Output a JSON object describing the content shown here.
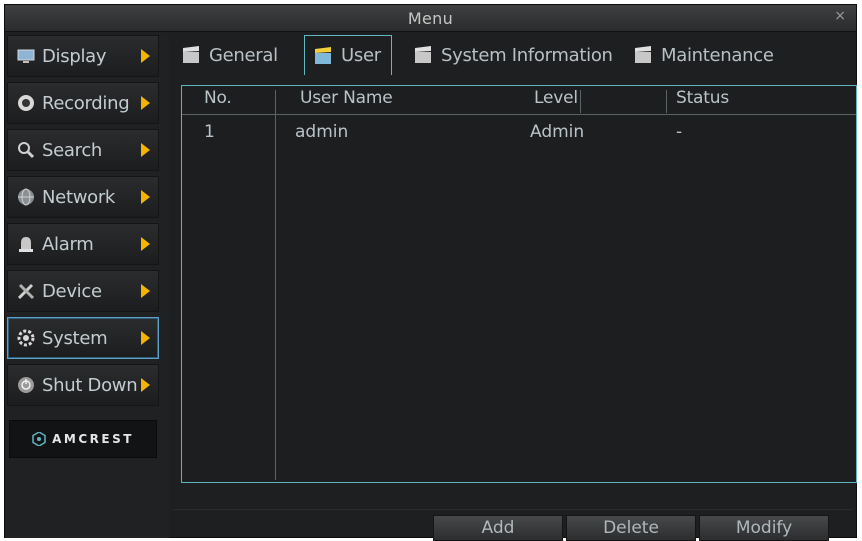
{
  "window": {
    "title": "Menu",
    "close_glyph": "×"
  },
  "sidebar": {
    "items": [
      {
        "label": "Display",
        "icon": "monitor-icon"
      },
      {
        "label": "Recording",
        "icon": "record-icon"
      },
      {
        "label": "Search",
        "icon": "search-icon"
      },
      {
        "label": "Network",
        "icon": "network-globe-icon"
      },
      {
        "label": "Alarm",
        "icon": "alarm-bell-icon"
      },
      {
        "label": "Device",
        "icon": "tools-icon"
      },
      {
        "label": "System",
        "icon": "gear-icon",
        "active": true
      },
      {
        "label": "Shut Down",
        "icon": "power-icon"
      }
    ],
    "logo": "AMCREST"
  },
  "tabs": [
    {
      "label": "General",
      "icon": "clapper-icon"
    },
    {
      "label": "User",
      "icon": "clapper-icon",
      "active": true
    },
    {
      "label": "System Information",
      "icon": "clapper-icon"
    },
    {
      "label": "Maintenance",
      "icon": "clapper-icon"
    }
  ],
  "table": {
    "headers": [
      "No.",
      "User Name",
      "Level",
      "Status"
    ],
    "rows": [
      {
        "no": "1",
        "user": "admin",
        "level": "Admin",
        "status": "-"
      }
    ]
  },
  "buttons": {
    "add": "Add",
    "delete": "Delete",
    "modify": "Modify"
  },
  "colors": {
    "accent": "#5fb4c2",
    "arrow": "#f4b400",
    "background": "#1e1f21"
  }
}
